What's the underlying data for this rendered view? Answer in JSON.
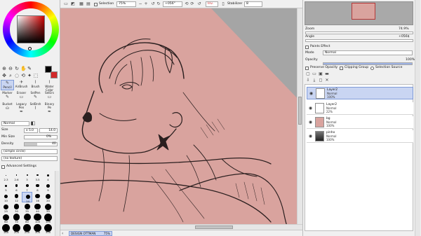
{
  "toolbar": {
    "selection_label": "Selection",
    "zoom": "75%",
    "angle": "+056°",
    "inv_label": "Inv.",
    "stabilizer_label": "Stabilizer",
    "stabilizer_value": "8"
  },
  "tools": {
    "row1": [
      "Pencil",
      "AirBrush",
      "Brush",
      "Water Color"
    ],
    "row2": [
      "Marker",
      "Eraser",
      "SelPen",
      "SelErs"
    ],
    "row3": [
      "Bucket",
      "Legacy Pen",
      "SelBrsh",
      "Binary Pe"
    ]
  },
  "brush_settings": {
    "blend_mode": "Normal",
    "size_label": "Size",
    "size_multiplier": "x 5.0",
    "size_value": "14.0",
    "min_size_label": "Min Size",
    "min_size_value": "0%",
    "density_label": "Density",
    "density_value": "40",
    "shape": "(simple circle)",
    "texture": "(no texture)",
    "advanced_label": "Advanced Settings"
  },
  "brush_presets": {
    "row1": [
      "2.3",
      "2.6",
      "3",
      "3.5",
      "4"
    ],
    "row2": [
      "5",
      "6",
      "7",
      "8",
      "9"
    ],
    "row3": [
      "10",
      "12",
      "14",
      "16",
      "20"
    ],
    "row4": [
      "25",
      "30",
      "35",
      "40",
      "50"
    ],
    "row5": [
      "60",
      "70",
      "80",
      "100",
      "120"
    ],
    "row6": [
      "160",
      "200",
      "250",
      "300",
      "350"
    ]
  },
  "status": {
    "doc_name": "DESIGN OTTMAN",
    "doc_zoom": "75%"
  },
  "navigator": {
    "zoom_label": "Zoom",
    "zoom_value": "74.9%",
    "angle_label": "Angle",
    "angle_value": "+056$"
  },
  "layer_panel": {
    "paints_effect_label": "Paints Effect",
    "mode_label": "Mode",
    "mode_value": "Normal",
    "opacity_label": "Opacity",
    "opacity_value": "100%",
    "preserve_opacity": "Preserve Opacity",
    "clipping_group": "Clipping Group",
    "selection_source": "Selection Source"
  },
  "layers": [
    {
      "name": "Layer2",
      "mode": "Normal",
      "opacity": "100%",
      "selected": true,
      "thumb_color": "#ffffff"
    },
    {
      "name": "Layer2",
      "mode": "Normal",
      "opacity": "22%",
      "selected": false,
      "thumb_color": "#ffffff"
    },
    {
      "name": "bg",
      "mode": "Normal",
      "opacity": "100%",
      "selected": false,
      "thumb_color": "#d9a39e"
    },
    {
      "name": "pinho",
      "mode": "Normal",
      "opacity": "100%",
      "selected": false,
      "thumb_color": "#555555"
    }
  ],
  "colors": {
    "canvas_bg": "#d9a39e",
    "selection_blue": "#c9d5f2",
    "accent_red": "#d2292a"
  }
}
